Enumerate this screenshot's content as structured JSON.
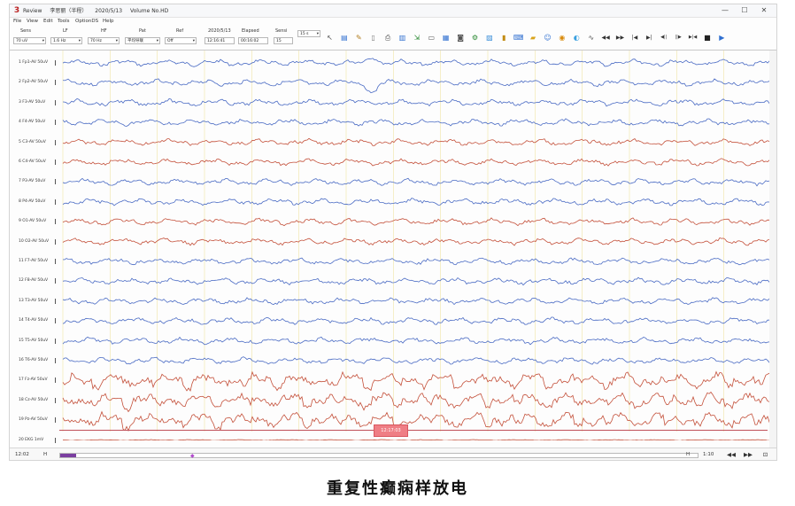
{
  "window": {
    "app_name": "Review",
    "patient": "李思丽（半程）",
    "date": "2020/5/13",
    "volume": "Volume No.HD",
    "minimize": "—",
    "maximize": "☐",
    "close": "✕"
  },
  "menu": [
    "File",
    "View",
    "Edit",
    "Tools",
    "OptionDS",
    "Help"
  ],
  "controls": {
    "sens": {
      "label": "Sens",
      "value": "70 uV"
    },
    "lf": {
      "label": "LF",
      "value": "1.6 Hz"
    },
    "hf": {
      "label": "HF",
      "value": "70 Hz"
    },
    "pat": {
      "label": "Pat",
      "value": "平均导联"
    },
    "ref": {
      "label": "Ref",
      "value": "Off"
    },
    "recdate": {
      "label": "2020/5/13",
      "value": "12:16:41"
    },
    "elapsed": {
      "label": "Elapsed",
      "value": "00:16:02"
    },
    "speed_label": "Sensi",
    "speed_value": "15",
    "page": {
      "label": "",
      "value": "15 s"
    }
  },
  "toolbar_icons": [
    {
      "name": "pointer-icon",
      "glyph": "↖",
      "color": "#555"
    },
    {
      "name": "montage-icon",
      "glyph": "▤",
      "color": "#2f6fd0"
    },
    {
      "name": "edit-icon",
      "glyph": "✎",
      "color": "#b07a1a"
    },
    {
      "name": "document-icon",
      "glyph": "▯",
      "color": "#777"
    },
    {
      "name": "print-icon",
      "glyph": "⎙",
      "color": "#555"
    },
    {
      "name": "chart-icon",
      "glyph": "▥",
      "color": "#2f6fd0"
    },
    {
      "name": "export-icon",
      "glyph": "⇲",
      "color": "#2c8a34"
    },
    {
      "name": "window-icon",
      "glyph": "▭",
      "color": "#555"
    },
    {
      "name": "image-icon",
      "glyph": "▦",
      "color": "#2f6fd0"
    },
    {
      "name": "camera-icon",
      "glyph": "◙",
      "color": "#555"
    },
    {
      "name": "settings-icon",
      "glyph": "⚙",
      "color": "#2c8a34"
    },
    {
      "name": "report-icon",
      "glyph": "▨",
      "color": "#3b8fd9"
    },
    {
      "name": "card-icon",
      "glyph": "▮",
      "color": "#c28b12"
    },
    {
      "name": "keyboard-icon",
      "glyph": "⌨",
      "color": "#2f6fd0"
    },
    {
      "name": "folder-icon",
      "glyph": "▰",
      "color": "#d9a41b"
    },
    {
      "name": "person-icon",
      "glyph": "☺",
      "color": "#2f6fd0"
    },
    {
      "name": "filter-icon",
      "glyph": "◉",
      "color": "#d98a0b"
    },
    {
      "name": "globe-icon",
      "glyph": "◐",
      "color": "#3aa0e0"
    },
    {
      "name": "wave-icon",
      "glyph": "∿",
      "color": "#555"
    },
    {
      "name": "rewind-icon",
      "glyph": "◀◀",
      "color": "#333"
    },
    {
      "name": "fast-forward-icon",
      "glyph": "▶▶",
      "color": "#333"
    },
    {
      "name": "skip-start-icon",
      "glyph": "|◀",
      "color": "#333"
    },
    {
      "name": "skip-end-icon",
      "glyph": "▶|",
      "color": "#333"
    },
    {
      "name": "step-back-icon",
      "glyph": "◀||",
      "color": "#333"
    },
    {
      "name": "step-forward-icon",
      "glyph": "||▶",
      "color": "#333"
    },
    {
      "name": "frame-icon",
      "glyph": "▶|◀",
      "color": "#333"
    },
    {
      "name": "stop-icon",
      "glyph": "■",
      "color": "#222"
    },
    {
      "name": "play-icon",
      "glyph": "▶",
      "color": "#2f6fd0"
    }
  ],
  "channels": [
    {
      "label": "1 Fp1-AV",
      "unit": "50uV",
      "color": "#4a6bc4"
    },
    {
      "label": "2 Fp2-AV",
      "unit": "50uV",
      "color": "#4a6bc4"
    },
    {
      "label": "3 F3-AV",
      "unit": "50uV",
      "color": "#4a6bc4"
    },
    {
      "label": "4 F4-AV",
      "unit": "50uV",
      "color": "#4a6bc4"
    },
    {
      "label": "5 C3-AV",
      "unit": "50uV",
      "color": "#c4503a"
    },
    {
      "label": "6 C4-AV",
      "unit": "50uV",
      "color": "#c4503a"
    },
    {
      "label": "7 P3-AV",
      "unit": "50uV",
      "color": "#4a6bc4"
    },
    {
      "label": "8 P4-AV",
      "unit": "50uV",
      "color": "#4a6bc4"
    },
    {
      "label": "9 O1-AV",
      "unit": "50uV",
      "color": "#c4503a"
    },
    {
      "label": "10 O2-AV",
      "unit": "50uV",
      "color": "#c4503a"
    },
    {
      "label": "11 F7-AV",
      "unit": "50uV",
      "color": "#4a6bc4"
    },
    {
      "label": "12 F8-AV",
      "unit": "50uV",
      "color": "#4a6bc4"
    },
    {
      "label": "13 T3-AV",
      "unit": "50uV",
      "color": "#4a6bc4"
    },
    {
      "label": "14 T4-AV",
      "unit": "50uV",
      "color": "#4a6bc4"
    },
    {
      "label": "15 T5-AV",
      "unit": "50uV",
      "color": "#4a6bc4"
    },
    {
      "label": "16 T6-AV",
      "unit": "50uV",
      "color": "#4a6bc4"
    },
    {
      "label": "17 Fz-AV",
      "unit": "50uV",
      "color": "#c4503a"
    },
    {
      "label": "18 Cz-AV",
      "unit": "50uV",
      "color": "#c4503a"
    },
    {
      "label": "19 Pz-AV",
      "unit": "50uV",
      "color": "#c4503a"
    },
    {
      "label": "20 EKG",
      "unit": "1mV",
      "color": "#c4503a"
    }
  ],
  "event_marker": "12:17:03",
  "bottom": {
    "start_time": "12:02",
    "prev": "H",
    "next": "H",
    "end_time": "1:10",
    "icons": [
      "◀◀",
      "▶▶",
      "⊡"
    ]
  },
  "caption": "重复性癫痫样放电"
}
